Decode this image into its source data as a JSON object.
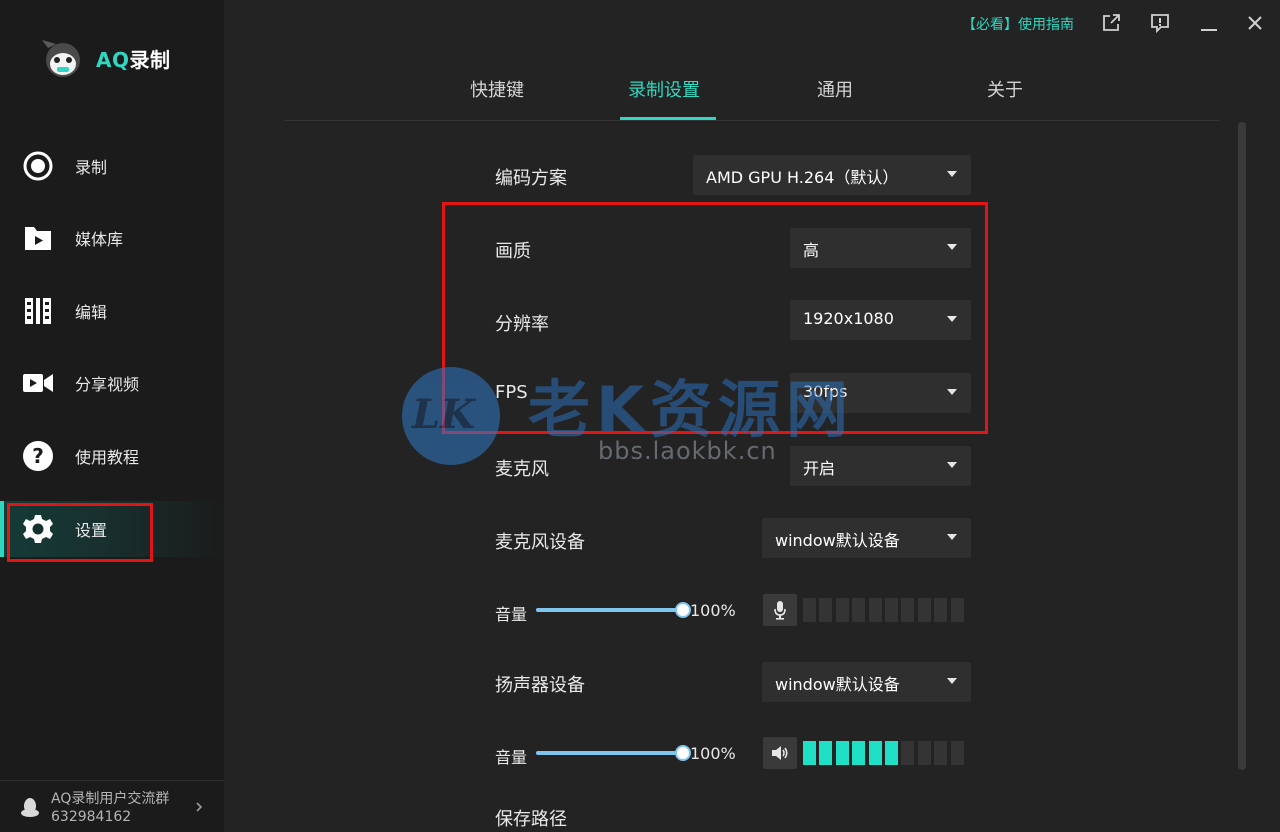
{
  "app": {
    "logo_prefix": "AQ",
    "logo_suffix": "录制"
  },
  "sidebar": {
    "items": [
      {
        "label": "录制",
        "icon": "record-icon"
      },
      {
        "label": "媒体库",
        "icon": "media-library-icon"
      },
      {
        "label": "编辑",
        "icon": "edit-film-icon"
      },
      {
        "label": "分享视频",
        "icon": "video-camera-icon"
      },
      {
        "label": "使用教程",
        "icon": "help-icon"
      },
      {
        "label": "设置",
        "icon": "gear-icon"
      }
    ],
    "active_index": 5,
    "qq_group": {
      "name": "AQ录制用户交流群",
      "number": "632984162"
    }
  },
  "topbar": {
    "guide_link": "【必看】使用指南"
  },
  "tabs": [
    {
      "label": "快捷键"
    },
    {
      "label": "录制设置"
    },
    {
      "label": "通用"
    },
    {
      "label": "关于"
    }
  ],
  "active_tab": 1,
  "settings": {
    "encoder": {
      "label": "编码方案",
      "value": "AMD GPU H.264（默认）"
    },
    "quality": {
      "label": "画质",
      "value": "高"
    },
    "resolution": {
      "label": "分辨率",
      "value": "1920x1080"
    },
    "fps": {
      "label": "FPS",
      "value": "30fps"
    },
    "microphone": {
      "label": "麦克风",
      "value": "开启"
    },
    "mic_device": {
      "label": "麦克风设备",
      "value": "window默认设备"
    },
    "mic_volume": {
      "label": "音量",
      "percent_text": "100%",
      "value": 1.0,
      "level_segments_on": 0,
      "level_segments_total": 10
    },
    "speaker_device": {
      "label": "扬声器设备",
      "value": "window默认设备"
    },
    "speaker_volume": {
      "label": "音量",
      "percent_text": "100%",
      "value": 1.0,
      "level_segments_on": 6,
      "level_segments_total": 10
    },
    "save_path": {
      "label": "保存路径"
    }
  },
  "watermark": {
    "logo": "LK",
    "title": "老K资源网",
    "url": "bbs.laokbk.cn"
  },
  "colors": {
    "accent": "#2fd7c1",
    "highlight_red": "#e01515",
    "slider": "#7fc6ef",
    "meter_on": "#1fe0c4"
  }
}
